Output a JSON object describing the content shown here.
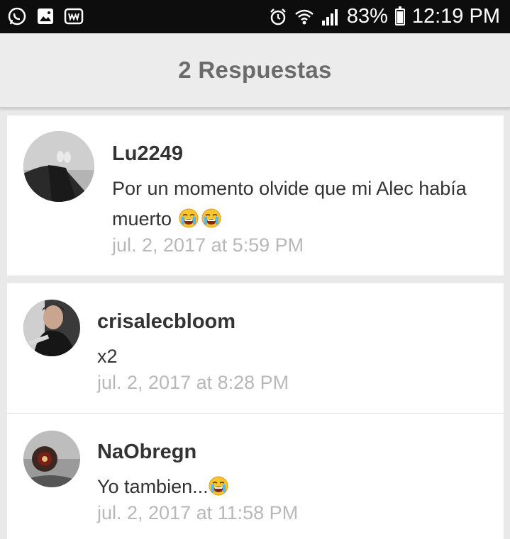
{
  "status_bar": {
    "battery": "83%",
    "time": "12:19 PM",
    "battery_level": 0.83,
    "left_icons": [
      "whatsapp-icon",
      "gallery-icon",
      "wattpad-icon"
    ],
    "right_icons": [
      "alarm-icon",
      "wifi-icon",
      "signal-icon",
      "battery-icon"
    ]
  },
  "header": {
    "title": "2 Respuestas"
  },
  "comments": [
    {
      "author": "Lu2249",
      "text_line1": "Por un momento olvide que mi Alec había",
      "text_line2": "muerto",
      "emoji_count": 2,
      "timestamp": "jul. 2, 2017 at 5:59 PM"
    },
    {
      "author": "crisalecbloom",
      "text": "x2",
      "timestamp": "jul. 2, 2017 at 8:28 PM"
    },
    {
      "author": "NaObregn",
      "text": "Yo tambien...",
      "emoji_count": 1,
      "timestamp": "jul. 2, 2017 at 11:58 PM"
    }
  ],
  "colors": {
    "status_bar_bg": "#0d0d0d",
    "header_bg": "#ececec",
    "page_bg": "#e9e9e9",
    "card_bg": "#ffffff",
    "title_gray": "#6b6b6b",
    "timestamp_gray": "#b8b8b8"
  }
}
